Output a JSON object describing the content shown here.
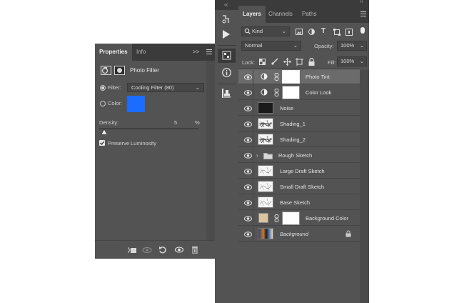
{
  "properties_panel": {
    "tabs": [
      "Properties",
      "Info"
    ],
    "menu_expand": ">>",
    "header_title": "Photo Filter",
    "filter_label": "Filter:",
    "filter_value": "Cooling Filter (80)",
    "color_label": "Color:",
    "color_swatch": "#1a6dff",
    "density_label": "Density:",
    "density_value": "5",
    "density_unit": "%",
    "density_level": 0.05,
    "preserve_label": "Preserve Luminosity",
    "preserve_checked": true
  },
  "layers_panel": {
    "tabs": [
      "Layers",
      "Channels",
      "Paths"
    ],
    "kind_label": "Kind",
    "blend_mode": "Normal",
    "opacity_label": "Opacity:",
    "opacity_value": "100%",
    "lock_label": "Lock:",
    "fill_label": "Fill:",
    "fill_value": "100%",
    "layers": [
      {
        "name": "Photo Tint",
        "type": "adjustment",
        "selected": true
      },
      {
        "name": "Color Look",
        "type": "adjustment"
      },
      {
        "name": "Noise",
        "type": "pixel"
      },
      {
        "name": "Shading_1",
        "type": "pixel"
      },
      {
        "name": "Shading_2",
        "type": "pixel"
      },
      {
        "name": "Rough Sketch",
        "type": "group"
      },
      {
        "name": "Large Draft Sketch",
        "type": "pixel"
      },
      {
        "name": "Small Draft Sketch",
        "type": "pixel"
      },
      {
        "name": "Base Sketch",
        "type": "pixel"
      },
      {
        "name": "Background Color",
        "type": "fill",
        "swatch": "#d9c6a1"
      },
      {
        "name": "Background",
        "type": "background",
        "locked": true
      }
    ]
  },
  "colors": {
    "panel_bg": "#535353",
    "tab_bg": "#3b3b3b",
    "selected_row": "#6b6b6b",
    "accent_blue": "#1a6dff"
  }
}
